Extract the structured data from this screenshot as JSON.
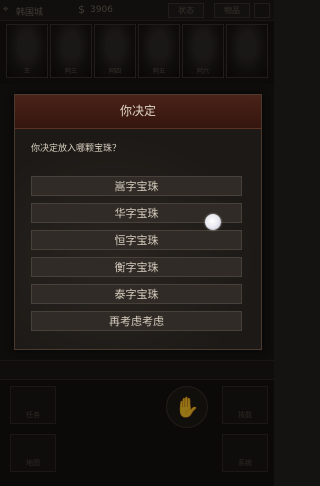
{
  "topbar": {
    "location": "韩国城",
    "money": "3906",
    "btn1": "状态",
    "btn2": "物品"
  },
  "portraits": [
    {
      "name": "王"
    },
    {
      "name": "阿三"
    },
    {
      "name": "阿四"
    },
    {
      "name": "阿五"
    },
    {
      "name": "阿六"
    }
  ],
  "dialog": {
    "title": "你决定",
    "question": "你决定放入哪颗宝珠？",
    "options": [
      {
        "label": "嵩字宝珠"
      },
      {
        "label": "华字宝珠"
      },
      {
        "label": "恒字宝珠"
      },
      {
        "label": "衡字宝珠"
      },
      {
        "label": "泰字宝珠"
      },
      {
        "label": "再考虑考虑"
      }
    ]
  },
  "bottom": {
    "btn_left_top": "任务",
    "btn_left_bottom": "地图",
    "btn_right_top": "技能",
    "btn_right_bottom": "系统"
  }
}
